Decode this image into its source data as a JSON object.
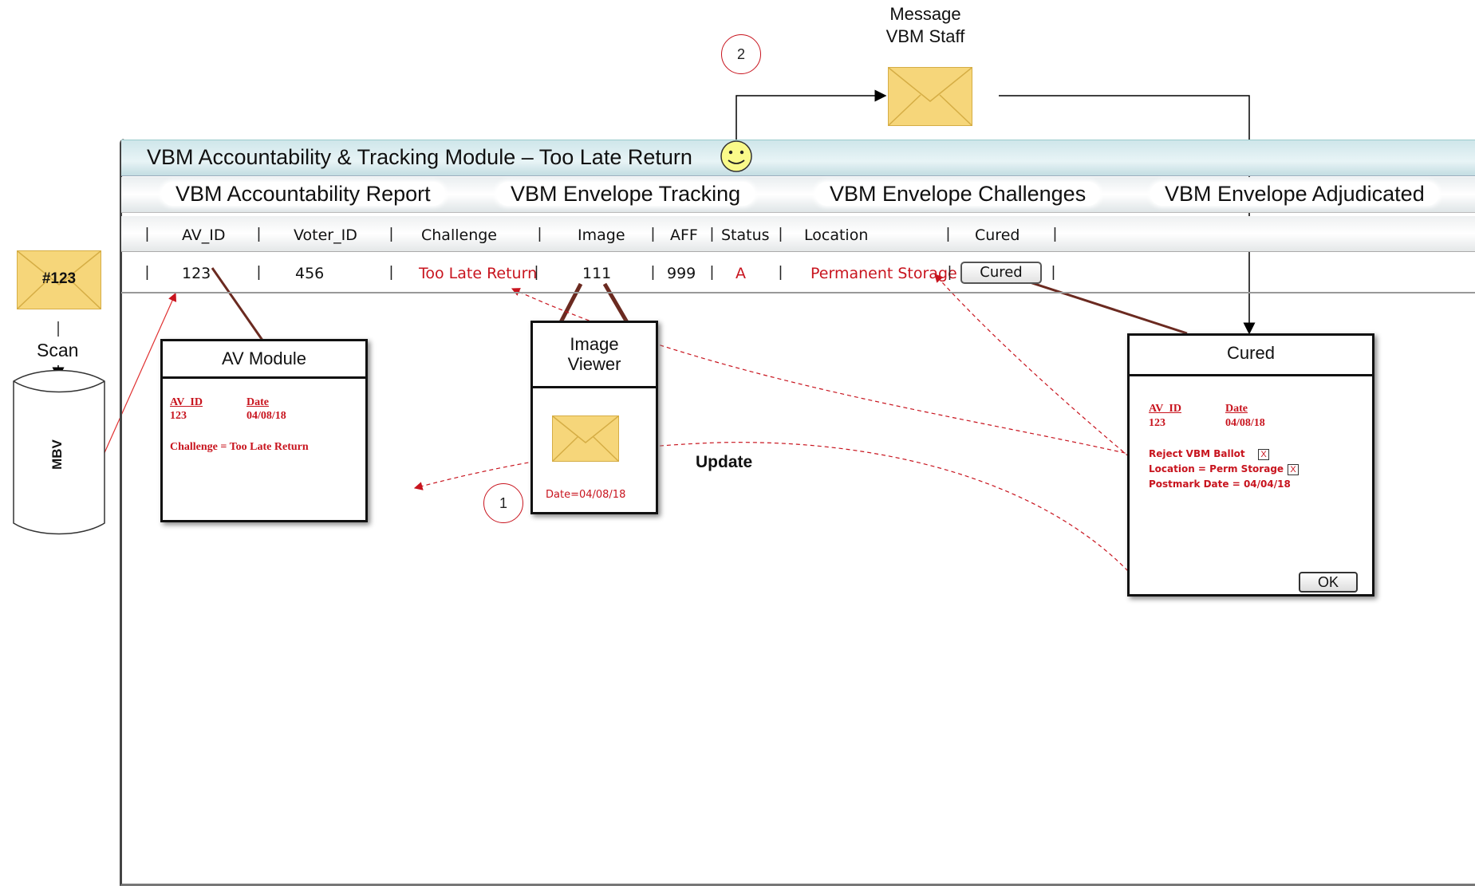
{
  "message": {
    "line1": "Message",
    "line2": "VBM Staff"
  },
  "step2": "2",
  "step1": "1",
  "envelope_tag": "#123",
  "scan_label": "Scan",
  "db_label": "MBV",
  "window": {
    "title": "VBM Accountability & Tracking Module – Too Late Return",
    "tabs": [
      "VBM Accountability Report",
      "VBM Envelope Tracking",
      "VBM Envelope Challenges",
      "VBM Envelope Adjudicated"
    ]
  },
  "table": {
    "headers": [
      "AV_ID",
      "Voter_ID",
      "Challenge",
      "Image",
      "AFF",
      "Status",
      "Location",
      "Cured"
    ],
    "row": {
      "av_id": "123",
      "voter_id": "456",
      "challenge": "Too Late Return",
      "image": "111",
      "aff": "999",
      "status": "A",
      "location": "Permanent Storage",
      "cured_button": "Cured"
    }
  },
  "av_module": {
    "title": "AV Module",
    "col1_label": "AV_ID",
    "col2_label": "Date",
    "col1_value": "123",
    "col2_value": "04/08/18",
    "challenge_line": "Challenge = Too Late Return"
  },
  "image_viewer": {
    "title_line1": "Image",
    "title_line2": "Viewer",
    "date": "Date=04/08/18"
  },
  "update_label": "Update",
  "cured_dialog": {
    "title": "Cured",
    "col1_label": "AV_ID",
    "col2_label": "Date",
    "col1_value": "123",
    "col2_value": "04/08/18",
    "reject": "Reject VBM Ballot",
    "location": "Location = Perm Storage",
    "postmark": "Postmark Date = 04/04/18",
    "check_mark": "X",
    "ok": "OK"
  },
  "colors": {
    "accent_red": "#c8141e",
    "envelope": "#f6d67a",
    "connector": "#6b2a20"
  }
}
